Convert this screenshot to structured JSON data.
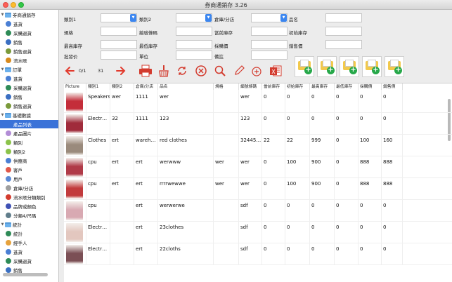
{
  "window": {
    "title": "券商通銷存 3.26"
  },
  "sidebar": {
    "items": [
      {
        "label": "券商通銷存",
        "type": "group"
      },
      {
        "label": "進貨",
        "type": "item",
        "color": "#4a7fd4"
      },
      {
        "label": "采購退貨",
        "type": "item",
        "color": "#2e8b57"
      },
      {
        "label": "銷售",
        "type": "item",
        "color": "#3a6fc2"
      },
      {
        "label": "銷售退貨",
        "type": "item",
        "color": "#7a9a3a"
      },
      {
        "label": "流水賬",
        "type": "item",
        "color": "#d88a1c"
      },
      {
        "label": "訂單",
        "type": "group"
      },
      {
        "label": "進貨",
        "type": "item",
        "color": "#4a7fd4"
      },
      {
        "label": "采購退貨",
        "type": "item",
        "color": "#2e8b57"
      },
      {
        "label": "銷售",
        "type": "item",
        "color": "#3a6fc2"
      },
      {
        "label": "銷售退貨",
        "type": "item",
        "color": "#7a9a3a"
      },
      {
        "label": "基礎數據",
        "type": "group"
      },
      {
        "label": "產品列表",
        "type": "item",
        "color": "#3a72d8",
        "selected": true
      },
      {
        "label": "產品圖片",
        "type": "item",
        "color": "#b28dd6"
      },
      {
        "label": "類別",
        "type": "item",
        "color": "#8bc34a"
      },
      {
        "label": "類別2",
        "type": "item",
        "color": "#8bc34a"
      },
      {
        "label": "供應商",
        "type": "item",
        "color": "#4a7fd4"
      },
      {
        "label": "客戶",
        "type": "item",
        "color": "#e0584a"
      },
      {
        "label": "用戶",
        "type": "item",
        "color": "#5b8ad6"
      },
      {
        "label": "倉庫/分店",
        "type": "item",
        "color": "#9e9e9e"
      },
      {
        "label": "流水賬分類類別",
        "type": "item",
        "color": "#d33b2e"
      },
      {
        "label": "品牌或顏色",
        "type": "item",
        "color": "#3f51b5"
      },
      {
        "label": "分類4/尺碼",
        "type": "item",
        "color": "#607d8b"
      },
      {
        "label": "統計",
        "type": "group"
      },
      {
        "label": "統計",
        "type": "item",
        "color": "#2e8b57"
      },
      {
        "label": "經手人",
        "type": "item",
        "color": "#e6a23c"
      },
      {
        "label": "進貨",
        "type": "item",
        "color": "#4a7fd4"
      },
      {
        "label": "采購退貨",
        "type": "item",
        "color": "#2e8b57"
      },
      {
        "label": "銷售",
        "type": "item",
        "color": "#3a6fc2"
      }
    ]
  },
  "form": {
    "row1": [
      {
        "label": "類別1",
        "value": "",
        "dropdown": true
      },
      {
        "label": "類別2",
        "value": "",
        "dropdown": true
      },
      {
        "label": "倉庫/分店",
        "value": "",
        "dropdown": true
      },
      {
        "label": "品名",
        "value": ""
      }
    ],
    "row2": [
      {
        "label": "規格",
        "value": ""
      },
      {
        "label": "編號條碼",
        "value": ""
      },
      {
        "label": "當前庫存",
        "value": ""
      },
      {
        "label": "初始庫存",
        "value": ""
      }
    ],
    "row3": [
      {
        "label": "最高庫存",
        "value": ""
      },
      {
        "label": "最低庫存",
        "value": ""
      },
      {
        "label": "採購價",
        "value": ""
      },
      {
        "label": "銷售價",
        "value": ""
      }
    ],
    "row4": [
      {
        "label": "批發价",
        "value": ""
      },
      {
        "label": "單位",
        "value": ""
      },
      {
        "label": "備註",
        "value": ""
      }
    ]
  },
  "toolbar": {
    "page_indicator": "0/1",
    "count": "31"
  },
  "table": {
    "headers": [
      "Picture",
      "類別1",
      "類別2",
      "倉庫/分店",
      "品名",
      "規格",
      "編號條碼",
      "當前庫存",
      "初始庫存",
      "最高庫存",
      "最低庫存",
      "採購價",
      "銷售價"
    ],
    "rows": [
      {
        "thumb": "#c42d3a",
        "c": [
          "Speakers",
          "wer",
          "1111",
          "wer",
          "",
          "wer",
          "0",
          "0",
          "0",
          "0",
          "0",
          "0"
        ]
      },
      {
        "thumb": "#a02b3b",
        "c": [
          "Electr…",
          "32",
          "1111",
          "123",
          "",
          "123",
          "0",
          "0",
          "0",
          "0",
          "0",
          "0"
        ]
      },
      {
        "thumb": "#9a8a7c",
        "c": [
          "Clothes",
          "ert",
          "wareh…",
          "red clothes",
          "",
          "32445…",
          "22",
          "22",
          "999",
          "0",
          "100",
          "160"
        ]
      },
      {
        "thumb": "#b03a48",
        "c": [
          "cpu",
          "ert",
          "ert",
          "werwww",
          "wer",
          "wer",
          "0",
          "100",
          "900",
          "0",
          "888",
          "888"
        ]
      },
      {
        "thumb": "#c23a3c",
        "c": [
          "cpu",
          "ert",
          "ert",
          "rrrrwewwe",
          "wer",
          "wer",
          "0",
          "100",
          "900",
          "0",
          "888",
          "888"
        ]
      },
      {
        "thumb": "#d8a9b2",
        "c": [
          "cpu",
          "",
          "ert",
          "werwerwe",
          "",
          "sdf",
          "0",
          "0",
          "0",
          "0",
          "0",
          "0"
        ]
      },
      {
        "thumb": "#e3c7bf",
        "c": [
          "Electr…",
          "",
          "ert",
          "23clothes",
          "",
          "sdf",
          "0",
          "0",
          "0",
          "0",
          "0",
          "0"
        ]
      },
      {
        "thumb": "#7b4f55",
        "c": [
          "Electr…",
          "",
          "ert",
          "22cloths",
          "",
          "sdf",
          "0",
          "0",
          "0",
          "0",
          "0",
          "0"
        ]
      }
    ]
  }
}
